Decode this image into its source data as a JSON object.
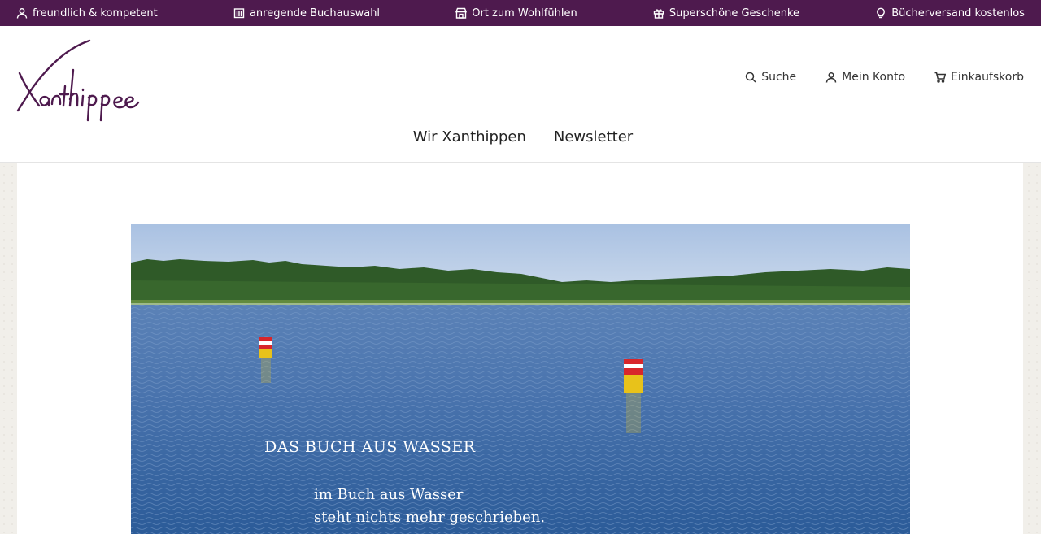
{
  "topbar": {
    "items": [
      {
        "label": "freundlich & kompetent",
        "icon": "user-icon"
      },
      {
        "label": "anregende Buchauswahl",
        "icon": "books-icon"
      },
      {
        "label": "Ort zum Wohlfühlen",
        "icon": "store-icon"
      },
      {
        "label": "Superschöne Geschenke",
        "icon": "gift-icon"
      },
      {
        "label": "Bücherversand kostenlos",
        "icon": "lightbulb-icon"
      }
    ],
    "bg_color": "#4e1a4e"
  },
  "header": {
    "logo_text": "Xanthippe",
    "actions": {
      "search": "Suche",
      "account": "Mein Konto",
      "cart": "Einkaufskorb"
    },
    "nav": {
      "item1": "Wir Xanthippen",
      "item2": "Newsletter"
    }
  },
  "hero": {
    "title": "DAS BUCH AUS WASSER",
    "lines": [
      "im Buch aus Wasser",
      "steht nichts mehr geschrieben."
    ]
  }
}
